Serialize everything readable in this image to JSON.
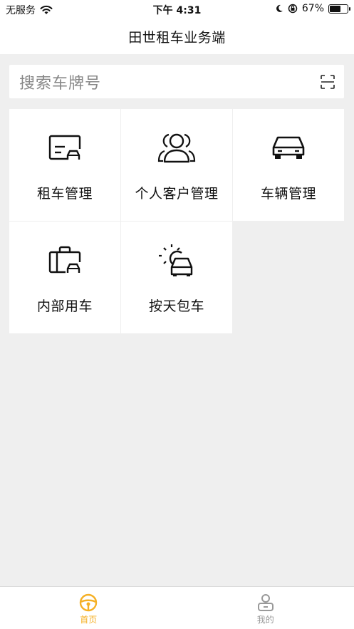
{
  "status_bar": {
    "carrier": "无服务",
    "time": "下午 4:31",
    "battery_percent": "67%",
    "battery_level": 0.67,
    "icons": [
      "wifi-icon",
      "moon-icon",
      "orientation-lock-icon",
      "battery-icon"
    ]
  },
  "nav": {
    "title": "田世租车业务端"
  },
  "search": {
    "placeholder": "搜索车牌号",
    "scan_icon": "scan-icon"
  },
  "menu": [
    {
      "label": "租车管理",
      "icon": "rental-card-icon"
    },
    {
      "label": "个人客户管理",
      "icon": "customers-icon"
    },
    {
      "label": "车辆管理",
      "icon": "car-icon"
    },
    {
      "label": "内部用车",
      "icon": "briefcase-car-icon"
    },
    {
      "label": "按天包车",
      "icon": "sun-car-icon"
    }
  ],
  "tabs": [
    {
      "label": "首页",
      "icon": "steering-wheel-icon",
      "active": true
    },
    {
      "label": "我的",
      "icon": "profile-icon",
      "active": false
    }
  ],
  "colors": {
    "accent": "#f5b025",
    "inactive": "#999999",
    "background": "#efefef"
  }
}
